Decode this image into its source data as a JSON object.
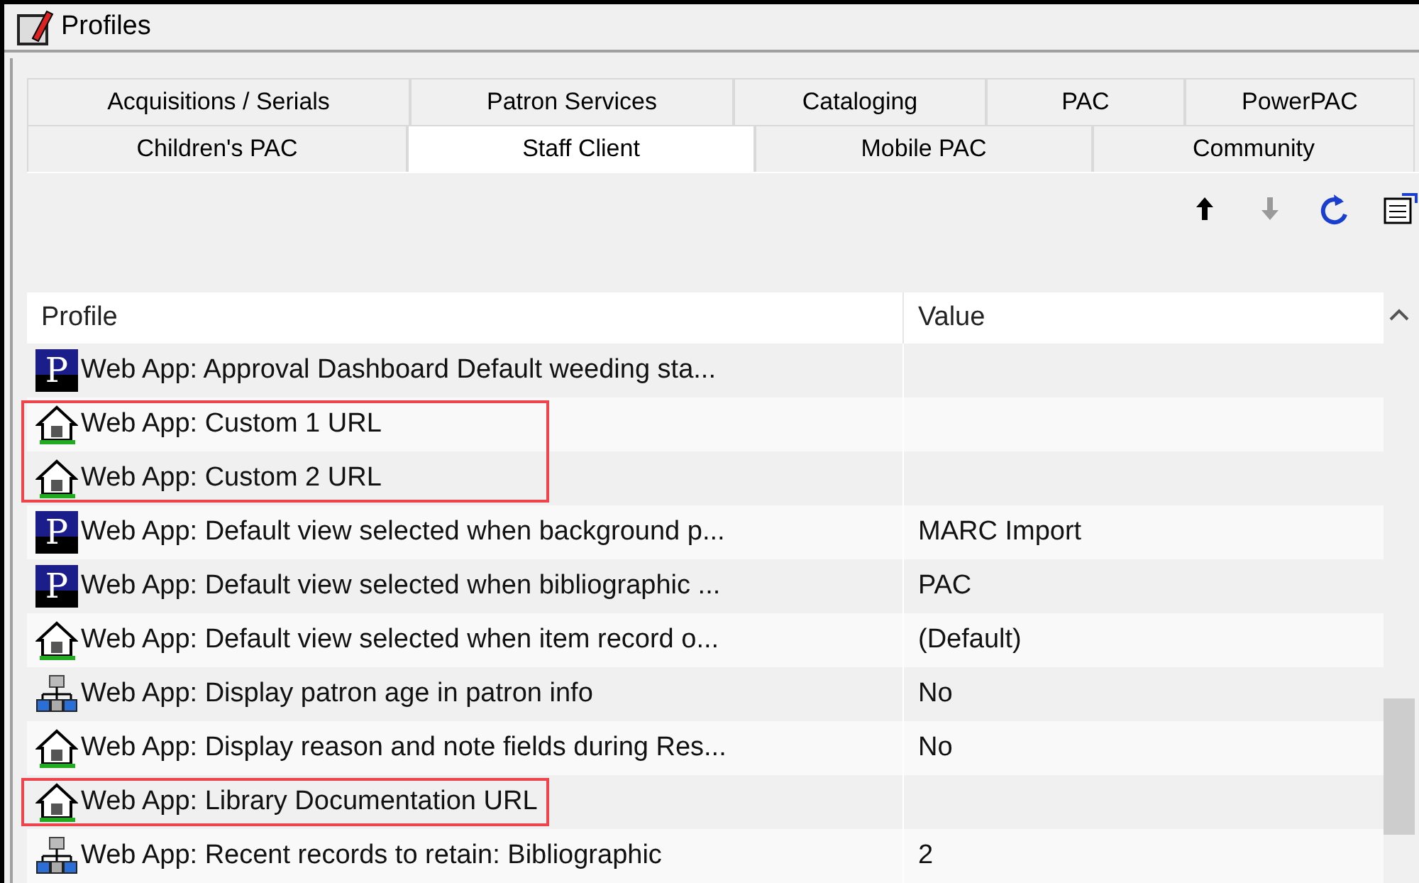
{
  "window": {
    "title": "Profiles"
  },
  "tab_rows": [
    [
      {
        "label": "Acquisitions / Serials",
        "selected": false
      },
      {
        "label": "Patron Services",
        "selected": false
      },
      {
        "label": "Cataloging",
        "selected": false
      },
      {
        "label": "PAC",
        "selected": false
      },
      {
        "label": "PowerPAC",
        "selected": false
      }
    ],
    [
      {
        "label": "Children's PAC",
        "selected": false
      },
      {
        "label": "Staff Client",
        "selected": true
      },
      {
        "label": "Mobile PAC",
        "selected": false
      },
      {
        "label": "Community",
        "selected": false
      }
    ]
  ],
  "toolbar": [
    {
      "kind": "up",
      "disabled": false
    },
    {
      "kind": "down",
      "disabled": true
    },
    {
      "kind": "refresh",
      "disabled": false
    },
    {
      "kind": "properties",
      "disabled": false
    }
  ],
  "table": {
    "columns": [
      "Profile",
      "Value"
    ],
    "rows": [
      {
        "kind": "system",
        "badge": "P",
        "profile": "Web App: Approval Dashboard Default weeding sta...",
        "value": "",
        "highlighted": false
      },
      {
        "kind": "library",
        "profile": "Web App: Custom 1 URL",
        "value": "",
        "highlighted": true
      },
      {
        "kind": "library",
        "profile": "Web App: Custom 2 URL",
        "value": "",
        "highlighted": true
      },
      {
        "kind": "system",
        "badge": "P",
        "profile": "Web App: Default view selected when background p...",
        "value": "MARC Import",
        "highlighted": false
      },
      {
        "kind": "system",
        "badge": "P",
        "profile": "Web App: Default view selected when bibliographic ...",
        "value": "PAC",
        "highlighted": false
      },
      {
        "kind": "library",
        "profile": "Web App: Default view selected when item record o...",
        "value": "(Default)",
        "highlighted": false
      },
      {
        "kind": "workstation",
        "profile": "Web App: Display patron age in patron info",
        "value": "No",
        "highlighted": false
      },
      {
        "kind": "library",
        "profile": "Web App: Display reason and note fields during Res...",
        "value": "No",
        "highlighted": false
      },
      {
        "kind": "library",
        "profile": "Web App: Library Documentation URL",
        "value": "",
        "highlighted": true
      },
      {
        "kind": "workstation",
        "profile": "Web App: Recent records to retain: Bibliographic",
        "value": "2",
        "highlighted": false
      }
    ]
  }
}
